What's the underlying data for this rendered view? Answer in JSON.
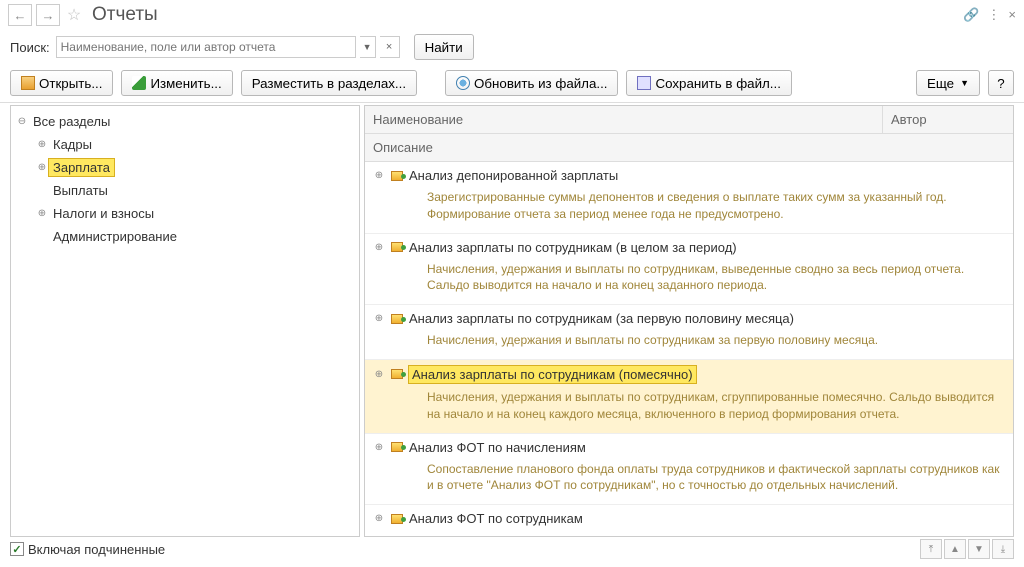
{
  "title": "Отчеты",
  "search": {
    "label": "Поиск:",
    "placeholder": "Наименование, поле или автор отчета",
    "find": "Найти"
  },
  "toolbar": {
    "open": "Открыть...",
    "edit": "Изменить...",
    "place": "Разместить в разделах...",
    "refresh": "Обновить из файла...",
    "save": "Сохранить в файл...",
    "more": "Еще",
    "help": "?"
  },
  "tree": {
    "root": "Все разделы",
    "items": [
      "Кадры",
      "Зарплата",
      "Выплаты",
      "Налоги и взносы",
      "Администрирование"
    ]
  },
  "columns": {
    "name": "Наименование",
    "author": "Автор",
    "desc": "Описание"
  },
  "reports": [
    {
      "title": "Анализ депонированной зарплаты",
      "desc": "Зарегистрированные суммы депонентов и сведения о выплате таких сумм за указанный год. Формирование отчета за период менее года не предусмотрено."
    },
    {
      "title": "Анализ зарплаты по сотрудникам (в целом за период)",
      "desc": "Начисления, удержания и выплаты по сотрудникам, выведенные сводно за весь период отчета. Сальдо выводится на начало и на конец заданного периода."
    },
    {
      "title": "Анализ зарплаты по сотрудникам (за первую половину месяца)",
      "desc": "Начисления, удержания и выплаты по сотрудникам за первую половину месяца."
    },
    {
      "title": "Анализ зарплаты по сотрудникам (помесячно)",
      "desc": "Начисления, удержания и выплаты по сотрудникам, сгруппированные помесячно. Сальдо выводится на начало и на конец каждого месяца, включенного в период формирования отчета."
    },
    {
      "title": "Анализ ФОТ по начислениям",
      "desc": "Сопоставление планового фонда оплаты труда сотрудников и фактической зарплаты сотрудников как и в отчете \"Анализ ФОТ по сотрудникам\", но с точностью до отдельных начислений."
    },
    {
      "title": "Анализ ФОТ по сотрудникам",
      "desc": ""
    }
  ],
  "footer": {
    "subord": "Включая подчиненные"
  }
}
